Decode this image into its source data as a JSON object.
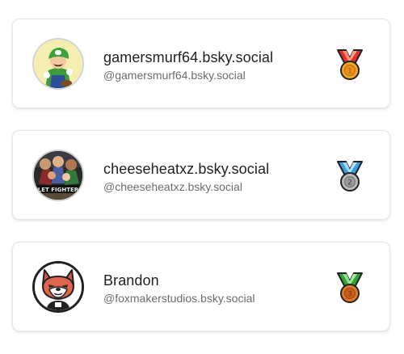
{
  "leaderboard": {
    "entries": [
      {
        "display_name": "gamersmurf64.bsky.social",
        "handle": "@gamersmurf64.bsky.social",
        "avatar": "green-cap-character-avatar",
        "medal": "1st-place-gold-medal-icon",
        "medal_rank": "1",
        "colors": {
          "ribbon_outer": "#e0312b",
          "ribbon_inner": "#ff8a6e",
          "medal": "#f5a623"
        }
      },
      {
        "display_name": "cheeseheatxz.bsky.social",
        "handle": "@cheeseheatxz.bsky.social",
        "avatar": "fighting-game-characters-avatar",
        "medal": "2nd-place-silver-medal-icon",
        "medal_rank": "2",
        "colors": {
          "ribbon_outer": "#3aa0e0",
          "ribbon_inner": "#9ad6ff",
          "medal": "#b8b8b8"
        }
      },
      {
        "display_name": "Brandon",
        "handle": "@foxmakerstudios.bsky.social",
        "avatar": "red-fox-mascot-avatar",
        "medal": "3rd-place-bronze-medal-icon",
        "medal_rank": "3",
        "colors": {
          "ribbon_outer": "#2fa53a",
          "ribbon_inner": "#8fe08a",
          "medal": "#e0782b"
        }
      }
    ]
  }
}
